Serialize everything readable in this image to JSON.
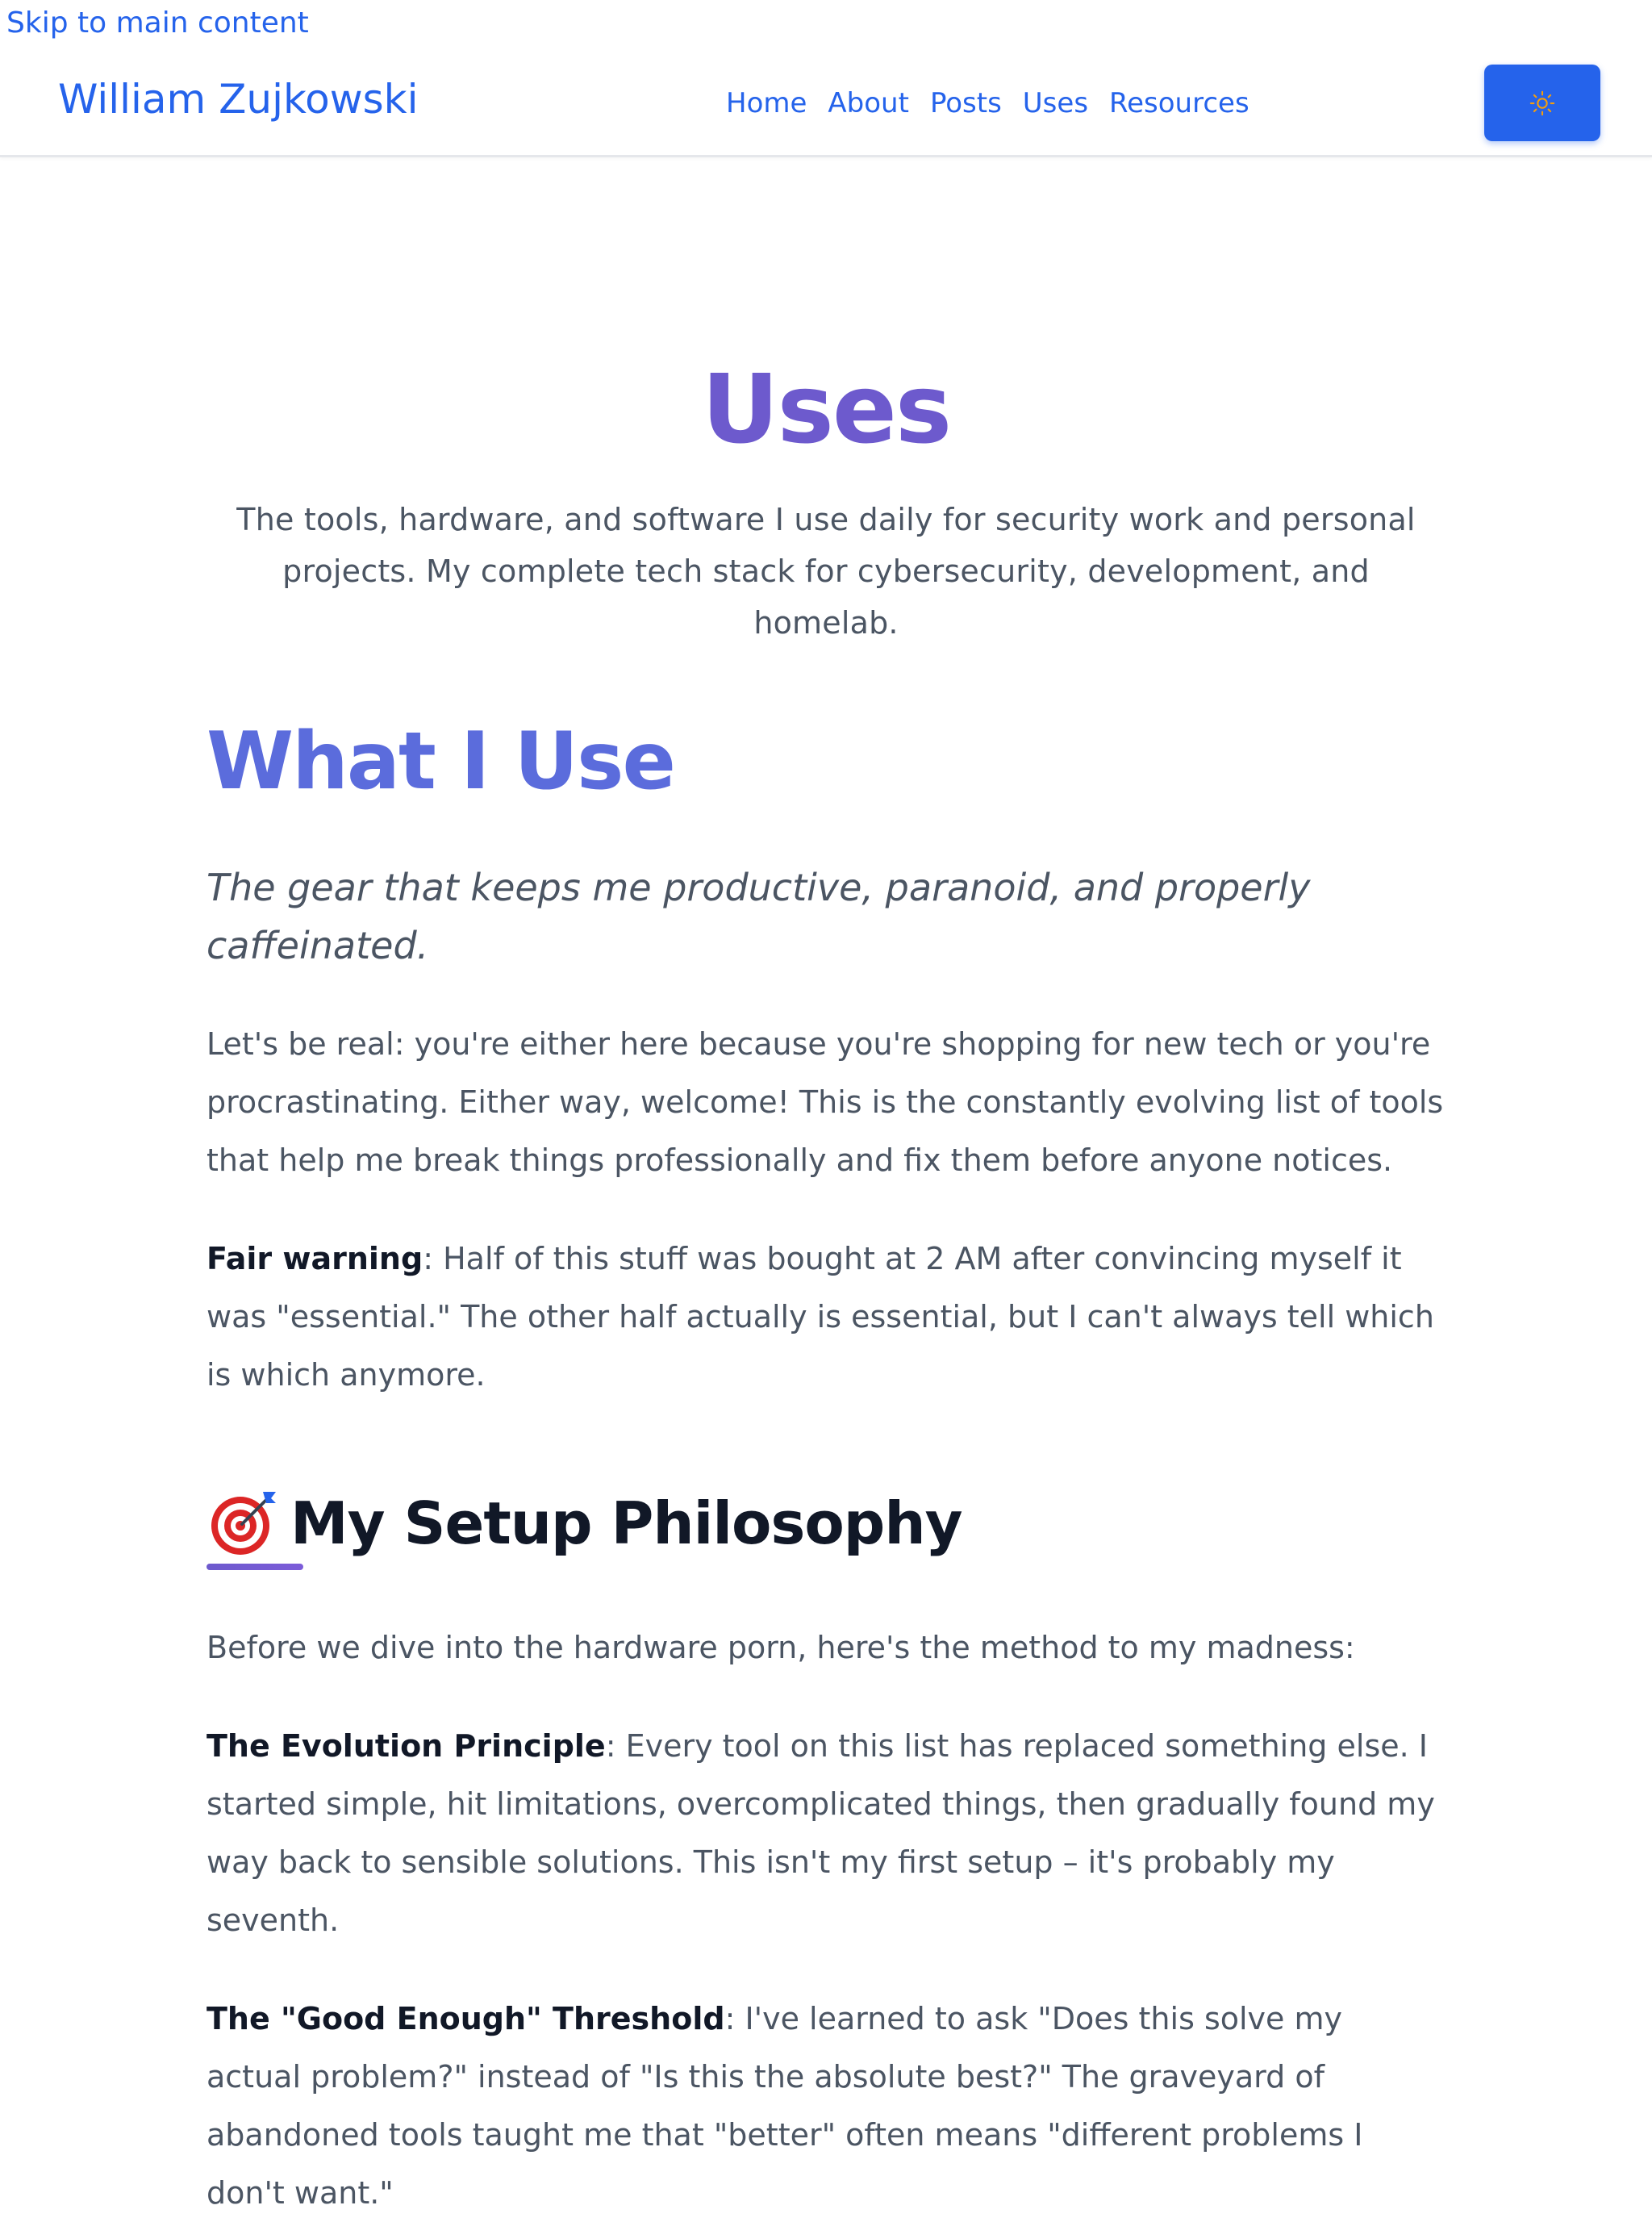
{
  "skip_link": "Skip to main content",
  "header": {
    "site_title": "William Zujkowski",
    "nav": [
      "Home",
      "About",
      "Posts",
      "Uses",
      "Resources"
    ],
    "theme_toggle_icon": "sun-icon"
  },
  "colors": {
    "accent": "#2563eb",
    "title_purple": "#6d5acd",
    "heading_indigo": "#5b6cdc",
    "text": "#4b5563",
    "text_strong": "#111827"
  },
  "main": {
    "page_title": "Uses",
    "page_description": "The tools, hardware, and software I use daily for security work and personal projects. My complete tech stack for cybersecurity, development, and homelab.",
    "heading": "What I Use",
    "tagline": "The gear that keeps me productive, paranoid, and properly caffeinated.",
    "intro": "Let's be real: you're either here because you're shopping for new tech or you're procrastinating. Either way, welcome! This is the constantly evolving list of tools that help me break things professionally and fix them before anyone notices.",
    "warning": {
      "label": "Fair warning",
      "text": ": Half of this stuff was bought at 2 AM after convincing myself it was \"essential.\" The other half actually is essential, but I can't always tell which is which anymore."
    },
    "section": {
      "icon": "target-icon",
      "title": "My Setup Philosophy",
      "lead": "Before we dive into the hardware porn, here's the method to my madness:",
      "principles": [
        {
          "label": "The Evolution Principle",
          "text": ": Every tool on this list has replaced something else. I started simple, hit limitations, overcomplicated things, then gradually found my way back to sensible solutions. This isn't my first setup – it's probably my seventh."
        },
        {
          "label": "The \"Good Enough\" Threshold",
          "text": ": I've learned to ask \"Does this solve my actual problem?\" instead of \"Is this the absolute best?\" The graveyard of abandoned tools taught me that \"better\" often means \"different problems I don't want.\""
        }
      ]
    }
  }
}
